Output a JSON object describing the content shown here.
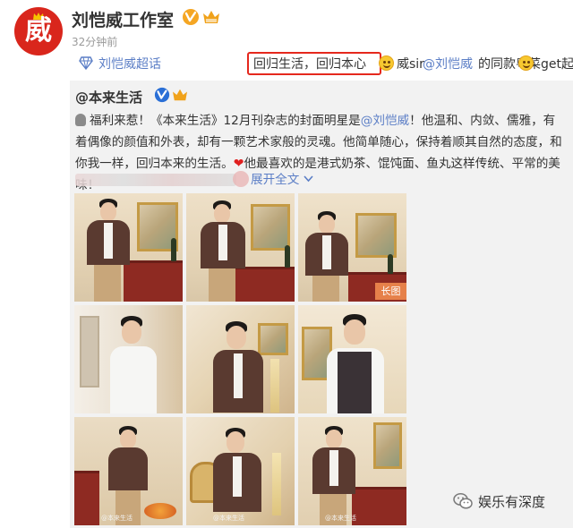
{
  "post": {
    "author": "刘恺威工作室",
    "avatar_glyph": "威",
    "time": "32分钟前",
    "topic_link": "刘恺威超话",
    "highlight_text": "回归生活，回归本心",
    "after_emoji_1": "威sir",
    "mention": "@刘恺威",
    "after_mention": " 的同款粤菜get起来"
  },
  "repost": {
    "author": "@本来生活",
    "text_1": "福利来惹！《本来生活》12月刊杂志的封面明星是",
    "mention": "@刘恺威",
    "text_2": "！他温和、内敛、儒雅，有着偶像的颜值和外表，却有一颗艺术家般的灵魂。他简单随心，保持着顺其自然的态度，和你我一样，回归本来的生活。",
    "text_3": "他最喜欢的是港式奶茶、馄饨面、鱼丸这样传统、平常的美味！",
    "expand": "展开全文",
    "long_image_badge": "长图",
    "photo_count": 9
  },
  "watermark": {
    "text": "娱乐有深度"
  },
  "colors": {
    "link": "#5b7ec6",
    "highlight_border": "#e5281d",
    "avatar_bg": "#d9261c",
    "repost_bg": "#f2f2f2",
    "verified": "#f5a623"
  },
  "icons": {
    "verified": "verified-v-icon",
    "vip": "vip-crown-icon",
    "topic": "diamond-topic-icon",
    "emoji": "smiley-emoji-icon",
    "microphone": "microphone-icon",
    "heart": "heart-icon",
    "chevron": "chevron-down-icon",
    "wechat": "wechat-logo-icon"
  }
}
